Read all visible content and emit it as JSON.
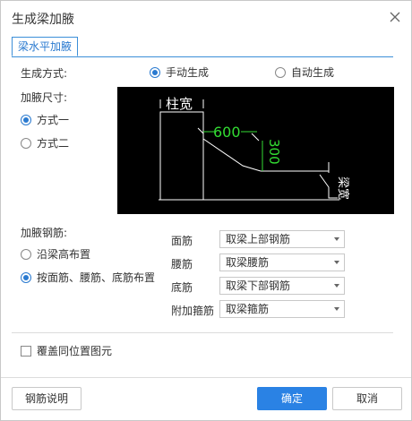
{
  "dialog": {
    "title": "生成梁加腋"
  },
  "tabs": [
    {
      "label": "梁水平加腋",
      "active": true
    }
  ],
  "generation": {
    "label": "生成方式:",
    "options": [
      {
        "label": "手动生成",
        "selected": true
      },
      {
        "label": "自动生成",
        "selected": false
      }
    ]
  },
  "haunch_size": {
    "label": "加腋尺寸:",
    "options": [
      {
        "label": "方式一",
        "selected": true
      },
      {
        "label": "方式二",
        "selected": false
      }
    ]
  },
  "diagram": {
    "column_width_label": "柱宽",
    "length_value": "600",
    "height_value": "300",
    "beam_width_label": "梁宽"
  },
  "rebar": {
    "label": "加腋钢筋:",
    "options": [
      {
        "label": "沿梁高布置",
        "selected": false
      },
      {
        "label": "按面筋、腰筋、底筋布置",
        "selected": true
      }
    ],
    "rows": [
      {
        "label": "面筋",
        "value": "取梁上部钢筋"
      },
      {
        "label": "腰筋",
        "value": "取梁腰筋"
      },
      {
        "label": "底筋",
        "value": "取梁下部钢筋"
      },
      {
        "label": "附加箍筋",
        "value": "取梁箍筋"
      }
    ]
  },
  "overwrite": {
    "label": "覆盖同位置图元",
    "checked": false
  },
  "footer": {
    "help_label": "钢筋说明",
    "ok_label": "确定",
    "cancel_label": "取消"
  },
  "colors": {
    "accent": "#2a82e4",
    "diagram_bg": "#000000",
    "diagram_line": "#ffffff",
    "diagram_dim": "#33dd33"
  }
}
